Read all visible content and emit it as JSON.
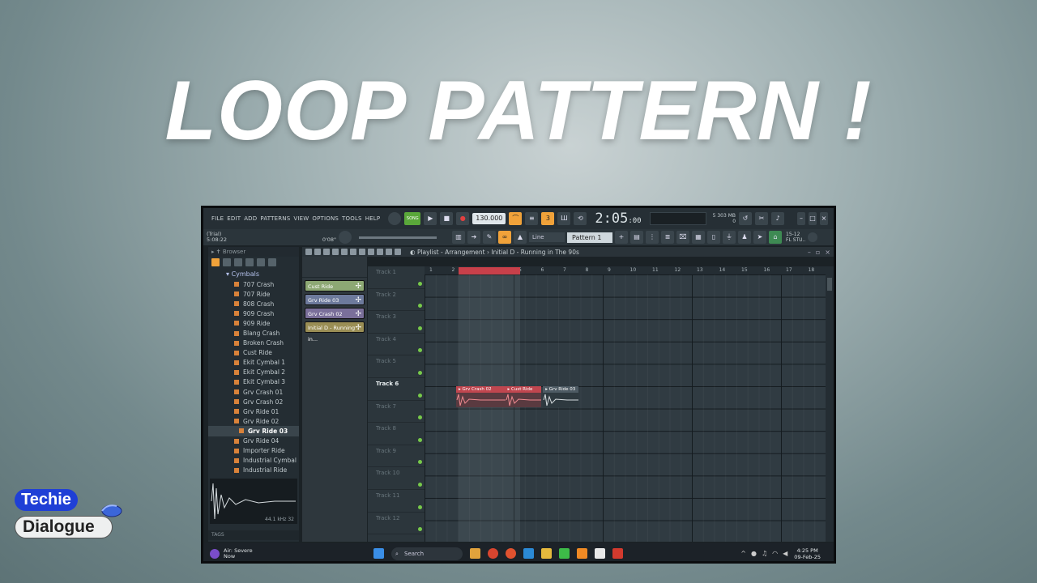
{
  "headline": "LOOP PATTERN !",
  "logo": {
    "line1": "Techie",
    "line2": "Dialogue"
  },
  "menu": [
    "FILE",
    "EDIT",
    "ADD",
    "PATTERNS",
    "VIEW",
    "OPTIONS",
    "TOOLS",
    "HELP"
  ],
  "transport": {
    "tempo": "130.000",
    "time": "2:05",
    "time_sub": ":00",
    "mode": "SONG"
  },
  "hint": {
    "line1": "(Trial)",
    "line2": "5:08:22",
    "right": "0'08\""
  },
  "toolbar": {
    "snap": "Line",
    "pattern": "Pattern 1",
    "stats": [
      "303 MB",
      "0",
      "5"
    ],
    "fl_label": "FL STU..",
    "fl_ver": "15-12"
  },
  "browser": {
    "header": "Browser",
    "folder": "Cymbals",
    "items": [
      "707 Crash",
      "707 Ride",
      "808 Crash",
      "909 Crash",
      "909 Ride",
      "Blang Crash",
      "Broken Crash",
      "Cust Ride",
      "Ekit Cymbal 1",
      "Ekit Cymbal 2",
      "Ekit Cymbal 3",
      "Grv Crash 01",
      "Grv Crash 02",
      "Grv Ride 01",
      "Grv Ride 02",
      "Grv Ride 03",
      "Grv Ride 04",
      "Importer Ride",
      "Industrial Cymbal",
      "Industrial Ride"
    ],
    "selected_index": 15,
    "sample_rate": "44.1 kHz 32",
    "tags": "TAGS"
  },
  "playlist": {
    "title": "Playlist - Arrangement",
    "arrangement": "Initial D - Running in The 90s",
    "patterns": [
      {
        "label": "Cust Ride",
        "color": "#8da874"
      },
      {
        "label": "Grv Ride 03",
        "color": "#6d7a9c"
      },
      {
        "label": "Grv Crash 02",
        "color": "#7a6f9a"
      },
      {
        "label": "Initial D - Running in...",
        "color": "#9a8e55"
      }
    ],
    "tracks": [
      "Track 1",
      "Track 2",
      "Track 3",
      "Track 4",
      "Track 5",
      "Track 6",
      "Track 7",
      "Track 8",
      "Track 9",
      "Track 10",
      "Track 11",
      "Track 12"
    ],
    "active_track_index": 5,
    "ruler": [
      "1",
      "2",
      "3",
      "4",
      "5",
      "6",
      "7",
      "8",
      "9",
      "10",
      "11",
      "12",
      "13",
      "14",
      "15",
      "16",
      "17",
      "18"
    ],
    "clips": [
      {
        "label": "Grv Crash 02",
        "start_bar": 2.2,
        "length_bars": 2.4,
        "color": "#c0464f"
      },
      {
        "label": "Cust Ride",
        "start_bar": 4.4,
        "length_bars": 1.6,
        "color": "#c0464f"
      },
      {
        "label": "Grv Ride 03",
        "start_bar": 6.1,
        "length_bars": 1.6,
        "color": "#4d5a63"
      }
    ],
    "loop_region": {
      "start_bar": 2.5,
      "end_bar": 5.0
    }
  },
  "taskbar": {
    "weather_title": "Air: Severe",
    "weather_sub": "Now",
    "search": "Search",
    "time": "4:25 PM",
    "date": "09-Feb-25"
  }
}
